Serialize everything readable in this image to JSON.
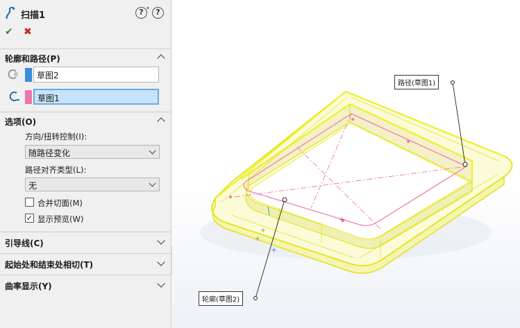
{
  "feature": {
    "title": "扫描1",
    "icon": "sweep-icon",
    "detail_preview_icon": "detailed-preview-icon",
    "help_icon": "help-icon"
  },
  "actions": {
    "ok_icon": "checkmark-icon",
    "cancel_icon": "close-icon"
  },
  "profile_path": {
    "title": "轮廓和路径(P)",
    "profile": {
      "icon": "profile-icon",
      "value": "草图2",
      "color": "#3b8edb"
    },
    "path": {
      "icon": "path-icon",
      "value": "草图1",
      "color": "#ee77aa"
    }
  },
  "options": {
    "title": "选项(O)",
    "orientation_label": "方向/扭转控制(I):",
    "orientation_value": "随路径变化",
    "alignment_label": "路径对齐类型(L):",
    "alignment_value": "无",
    "merge_faces": {
      "label": "合并切面(M)",
      "checked": false
    },
    "show_preview": {
      "label": "显示预览(W)",
      "checked": true
    }
  },
  "guide_curves": {
    "title": "引导线(C)"
  },
  "tangency": {
    "title": "起始处和结束处相切(T)"
  },
  "curvature": {
    "title": "曲率显示(Y)"
  },
  "viewport": {
    "path_callout": "路径(草图1)",
    "profile_callout": "轮廓(草图2)",
    "model_color": "#f2f23a"
  }
}
